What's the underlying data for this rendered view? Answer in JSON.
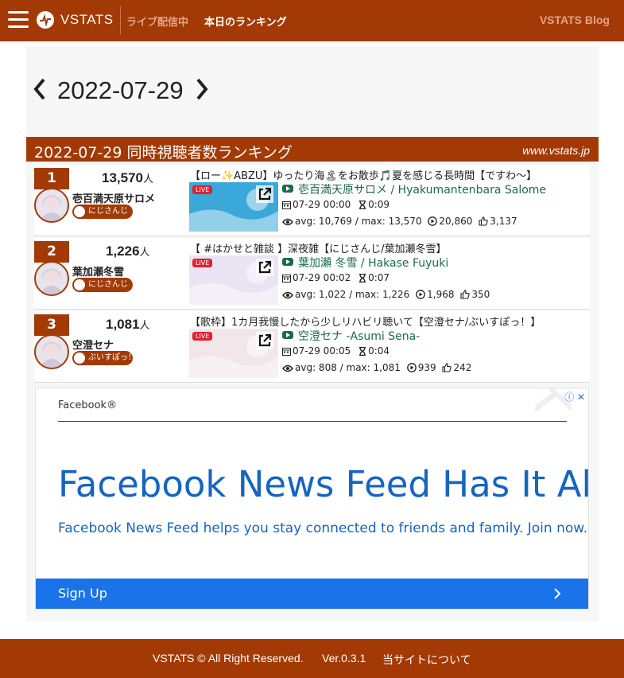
{
  "nav": {
    "brand": "VSTATS",
    "live": "ライブ配信中",
    "ranking": "本日のランキング",
    "blog": "VSTATS Blog"
  },
  "date": "2022-07-29",
  "ranking": {
    "title": "2022-07-29 同時視聴者数ランキング",
    "site": "www.vstats.jp",
    "rows": [
      {
        "rank": "1",
        "viewers": "13,570",
        "unit": "人",
        "name": "壱百満天原サロメ",
        "group": "にじさんじ",
        "stream_title": "【ロー✨ABZU】ゆったり海🏝をお散歩🎵夏を感じる長時間【ですわ～】",
        "channel": "壱百満天原サロメ / Hyakumantenbara Salome",
        "start": "07-29 00:00",
        "duration": "0:09",
        "stats": "avg: 10,769 / max: 13,570",
        "views": "20,860",
        "likes": "3,137",
        "live": "LIVE",
        "thumb_color": "#3aa8d8"
      },
      {
        "rank": "2",
        "viewers": "1,226",
        "unit": "人",
        "name": "葉加瀬冬雪",
        "group": "にじさんじ",
        "stream_title": "【 #はかせと雑談 】深夜雑【にじさんじ/葉加瀬冬雪】",
        "channel": "葉加瀬 冬雪 / Hakase Fuyuki",
        "start": "07-29 00:02",
        "duration": "0:07",
        "stats": "avg: 1,022 / max: 1,226",
        "views": "1,968",
        "likes": "350",
        "live": "LIVE",
        "thumb_color": "#e9e3f3"
      },
      {
        "rank": "3",
        "viewers": "1,081",
        "unit": "人",
        "name": "空澄セナ",
        "group": "ぶいすぽっ！",
        "stream_title": "【歌枠】1カ月我慢したから少しリハビリ聴いて【空澄セナ/ぶいすぽっ！】",
        "channel": "空澄セナ -Asumi Sena-",
        "start": "07-29 00:05",
        "duration": "0:04",
        "stats": "avg: 808 / max: 1,081",
        "views": "939",
        "likes": "242",
        "live": "LIVE",
        "thumb_color": "#f1e6ea"
      }
    ]
  },
  "ad": {
    "brand": "Facebook®",
    "headline": "Facebook News Feed Has It All",
    "body": "Facebook News Feed helps you stay connected to friends and family. Join now.",
    "cta": "Sign Up",
    "watermark": "Facebook"
  },
  "footer": {
    "copyright": "VSTATS © All Right Reserved.",
    "version": "Ver.0.3.1",
    "about": "当サイトについて"
  },
  "colors": {
    "brand": "#a33a06",
    "channel": "#1b6b47",
    "ad_blue": "#1a73e8"
  }
}
